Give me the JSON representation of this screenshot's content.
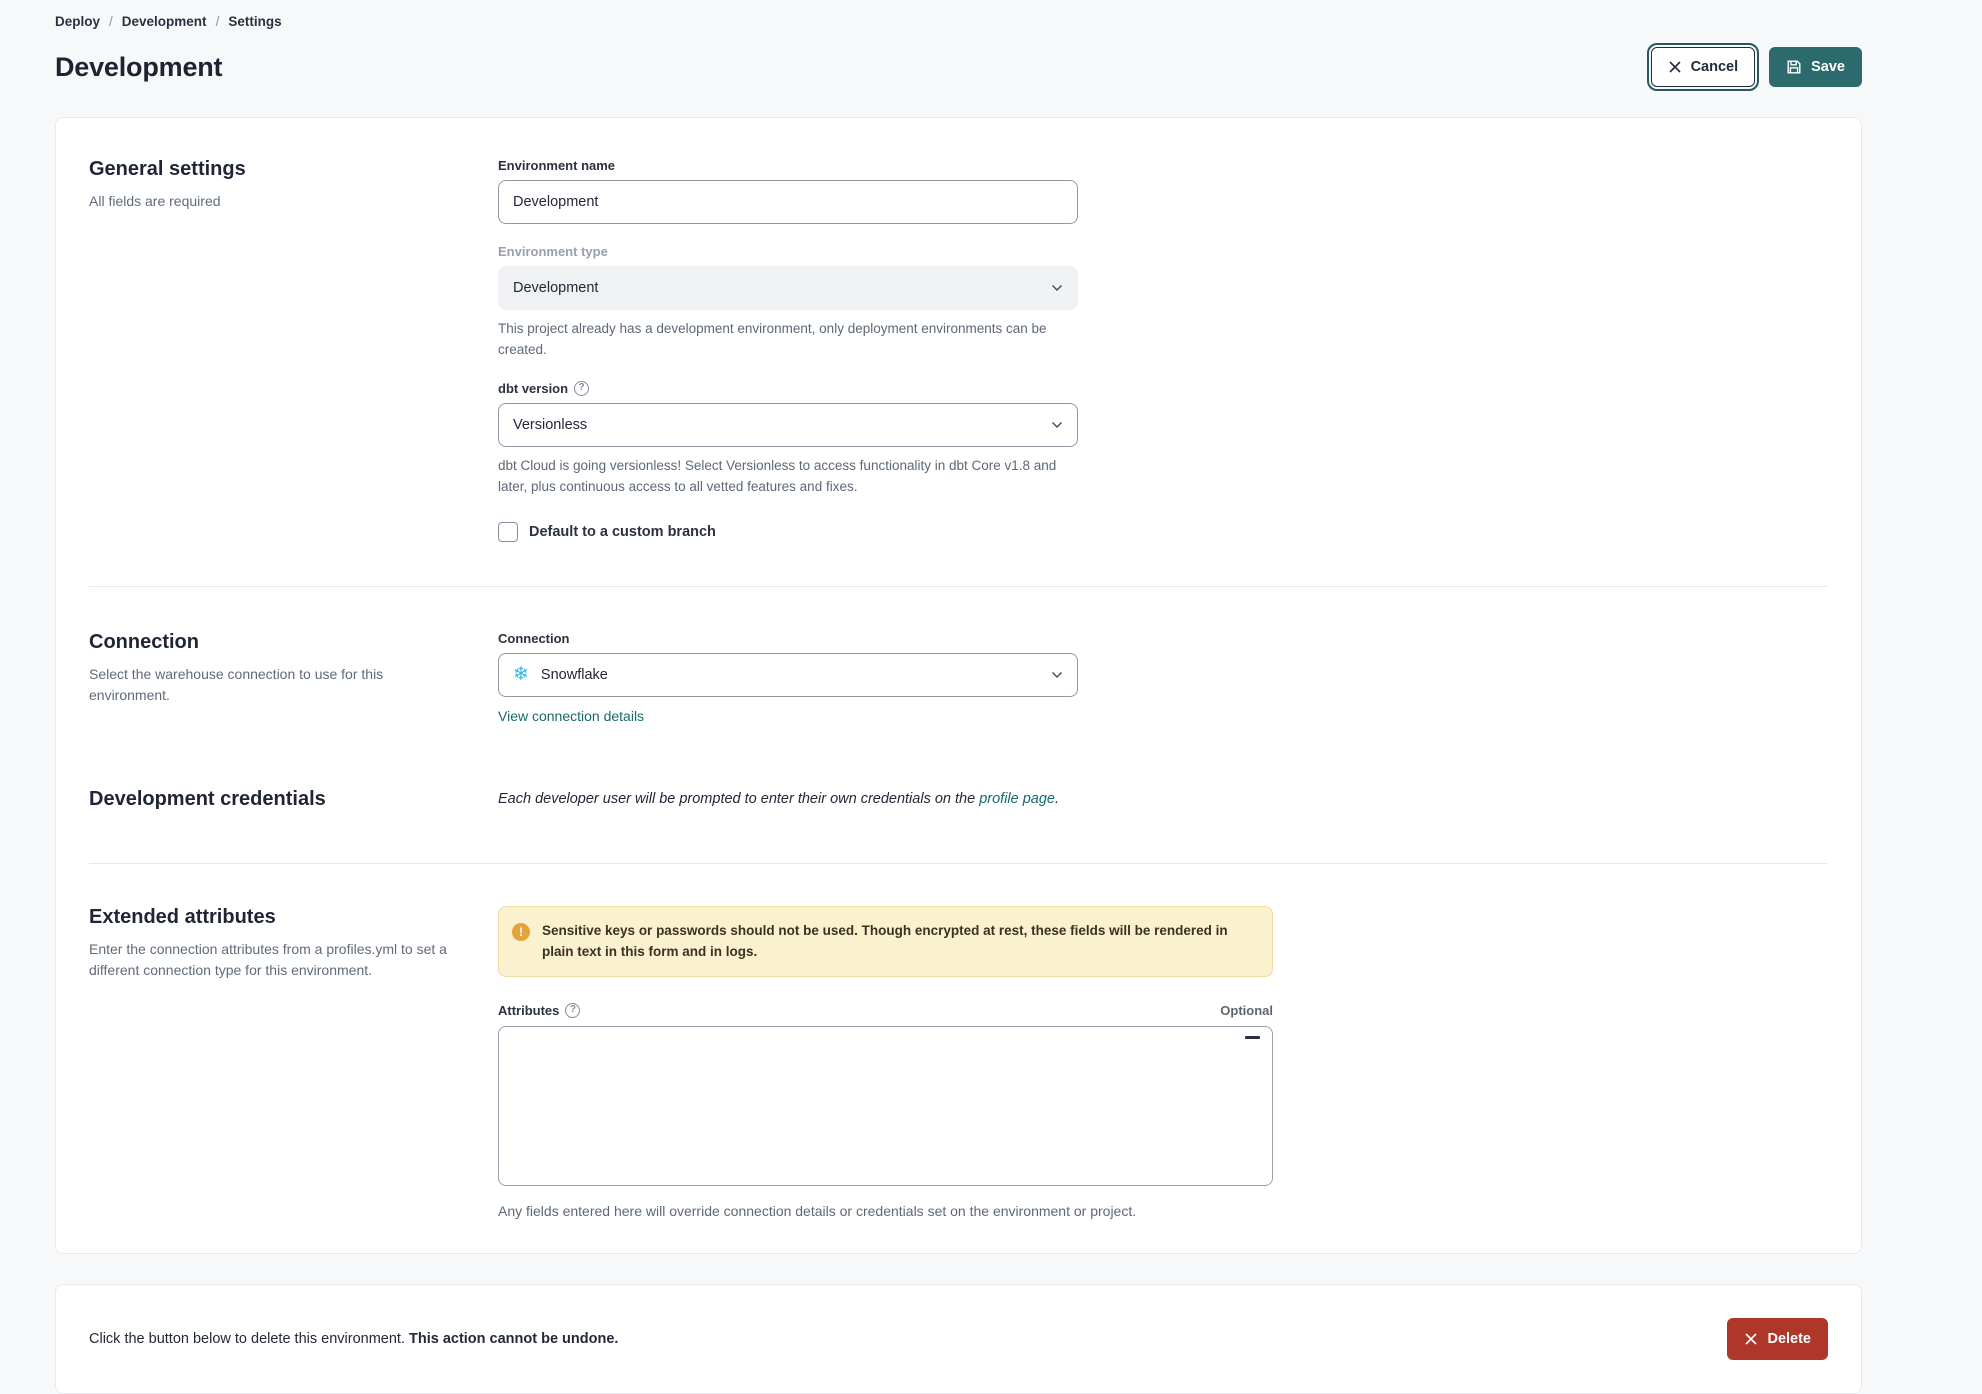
{
  "breadcrumb": {
    "separator": "/",
    "items": [
      "Deploy",
      "Development",
      "Settings"
    ]
  },
  "header": {
    "title": "Development",
    "cancel_label": "Cancel",
    "save_label": "Save"
  },
  "general": {
    "heading": "General settings",
    "subheading": "All fields are required",
    "env_name_label": "Environment name",
    "env_name_value": "Development",
    "env_type_label": "Environment type",
    "env_type_value": "Development",
    "env_type_help": "This project already has a development environment, only deployment environments can be created.",
    "dbt_version_label": "dbt version",
    "dbt_version_value": "Versionless",
    "dbt_version_help": "dbt Cloud is going versionless! Select Versionless to access functionality in dbt Core v1.8 and later, plus continuous access to all vetted features and fixes.",
    "custom_branch_label": "Default to a custom branch"
  },
  "connection": {
    "heading": "Connection",
    "subheading": "Select the warehouse connection to use for this environment.",
    "label": "Connection",
    "value": "Snowflake",
    "link": "View connection details"
  },
  "credentials": {
    "heading": "Development credentials",
    "note_prefix": "Each developer user will be prompted to enter their own credentials on the ",
    "note_link": "profile page",
    "note_suffix": "."
  },
  "extended": {
    "heading": "Extended attributes",
    "subheading": "Enter the connection attributes from a profiles.yml to set a different connection type for this environment.",
    "warning": "Sensitive keys or passwords should not be used. Though encrypted at rest, these fields will be rendered in plain text in this form and in logs.",
    "attributes_label": "Attributes",
    "optional_label": "Optional",
    "attributes_value": "",
    "footer": "Any fields entered here will override connection details or credentials set on the environment or project."
  },
  "danger": {
    "text_normal": "Click the button below to delete this environment. ",
    "text_bold": "This action cannot be undone.",
    "delete_label": "Delete"
  },
  "icons": {
    "help_glyph": "?",
    "warning_glyph": "!",
    "snowflake_glyph": "❄"
  },
  "colors": {
    "primary_teal": "#2D6A6D",
    "link_teal": "#17696c",
    "danger_red": "#AF372A",
    "warning_bg": "#FAF1CF",
    "warning_icon": "#E7A33B",
    "snowflake_blue": "#2FB5E8",
    "page_bg": "#F7F8FA"
  }
}
